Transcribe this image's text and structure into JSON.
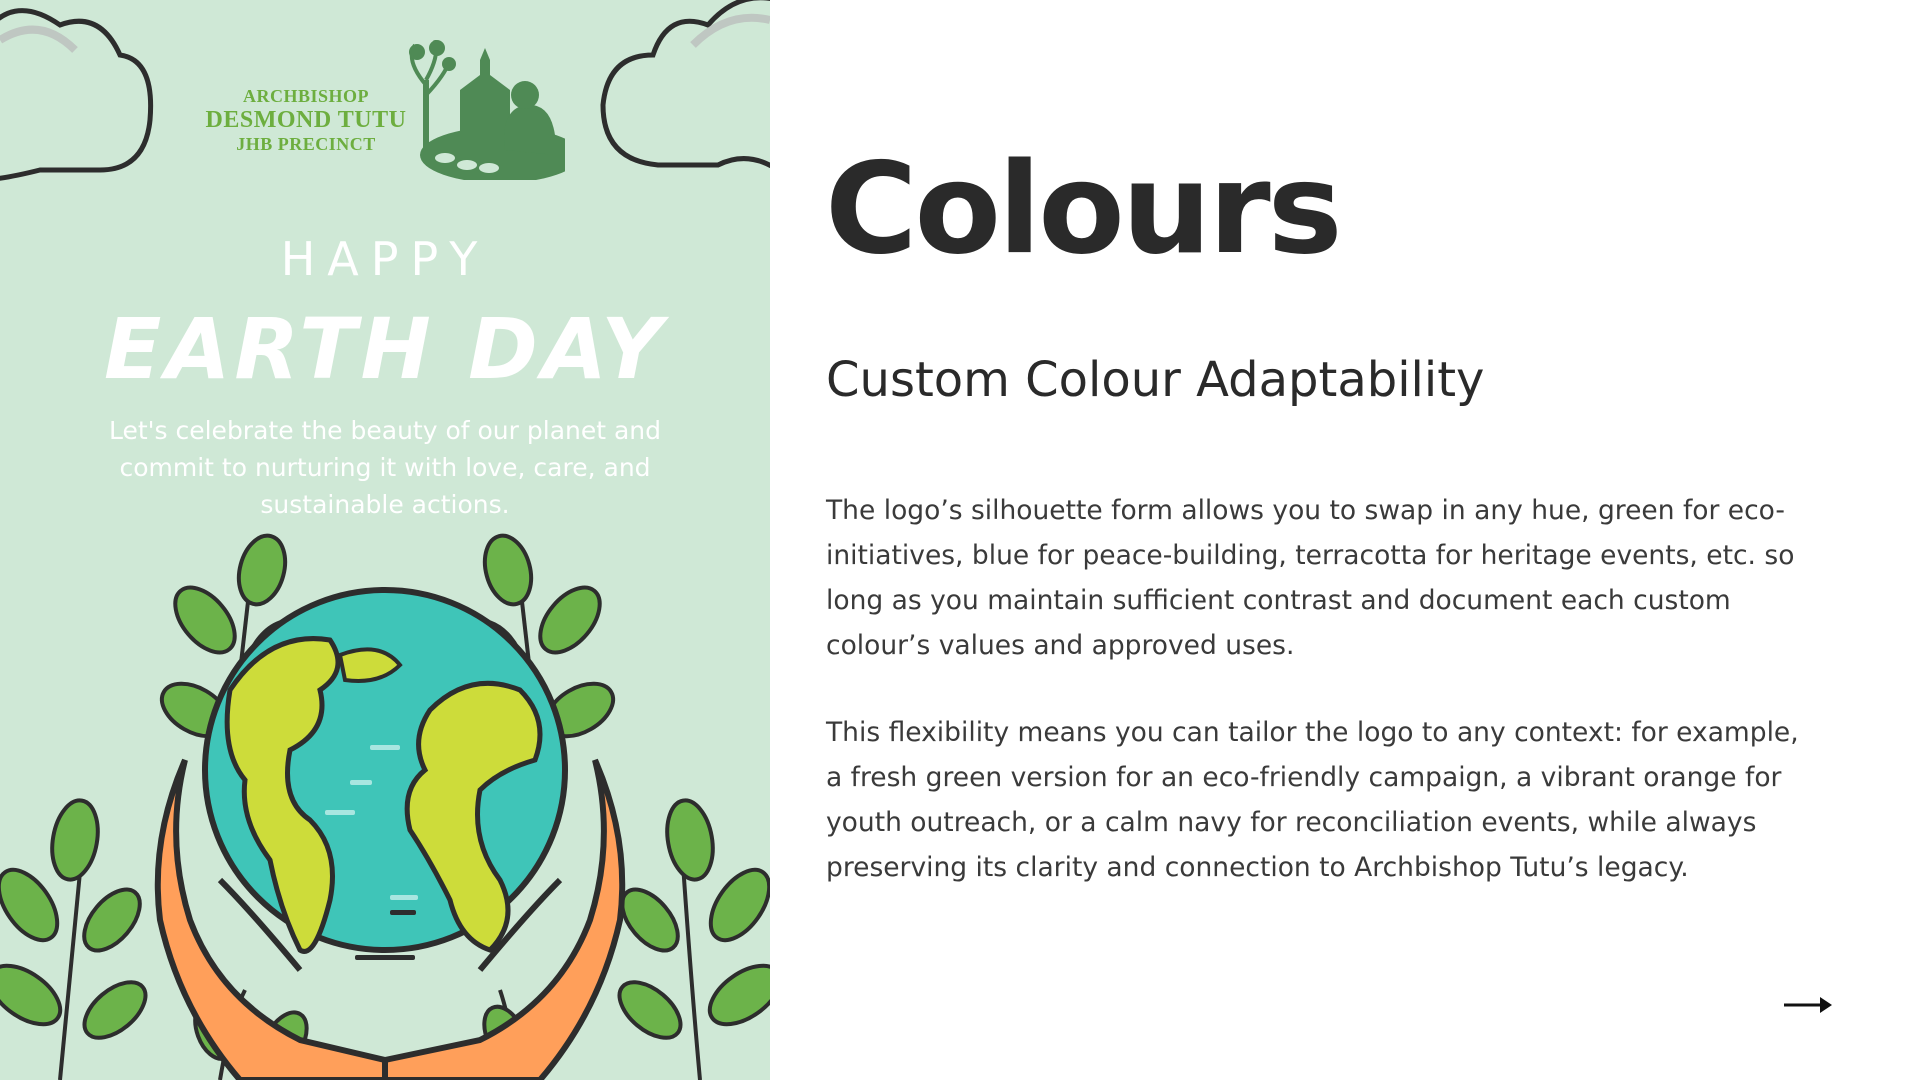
{
  "poster": {
    "logo": {
      "line1": "ARCHBISHOP",
      "line2": "DESMOND TUTU",
      "line3": "JHB PRECINCT"
    },
    "happy": "HAPPY",
    "earth_day": "EARTH DAY",
    "message": "Let's celebrate the beauty of our planet and commit to nurturing it with love, care, and sustainable actions."
  },
  "slide": {
    "heading": "Colours",
    "subheading": "Custom Colour Adaptability",
    "paragraph1": "The logo’s silhouette form allows you to swap in any hue, green for eco-initiatives, blue for peace-building, terracotta for heritage events, etc. so long as you maintain sufficient contrast and document each custom colour’s values and approved uses.",
    "paragraph2": "This flexibility means you can tailor the logo to any context: for example, a fresh green version for an eco-friendly campaign, a vibrant orange for youth outreach, or a calm navy for reconciliation events, while always preserving its clarity and connection to Archbishop Tutu’s legacy."
  },
  "navigation": {
    "next_icon": "arrow-right-icon"
  },
  "colors": {
    "poster_background": "#cfe8d6",
    "logo_green": "#6dae3f",
    "logo_dark_green": "#4f8a55",
    "leaf_green": "#6cb34a",
    "ocean_teal": "#3fc5b8",
    "land_lime": "#cddc3a",
    "hand_orange": "#ff9f5a",
    "heading_text": "#2a2a2a",
    "body_text": "#3a3a3a"
  }
}
